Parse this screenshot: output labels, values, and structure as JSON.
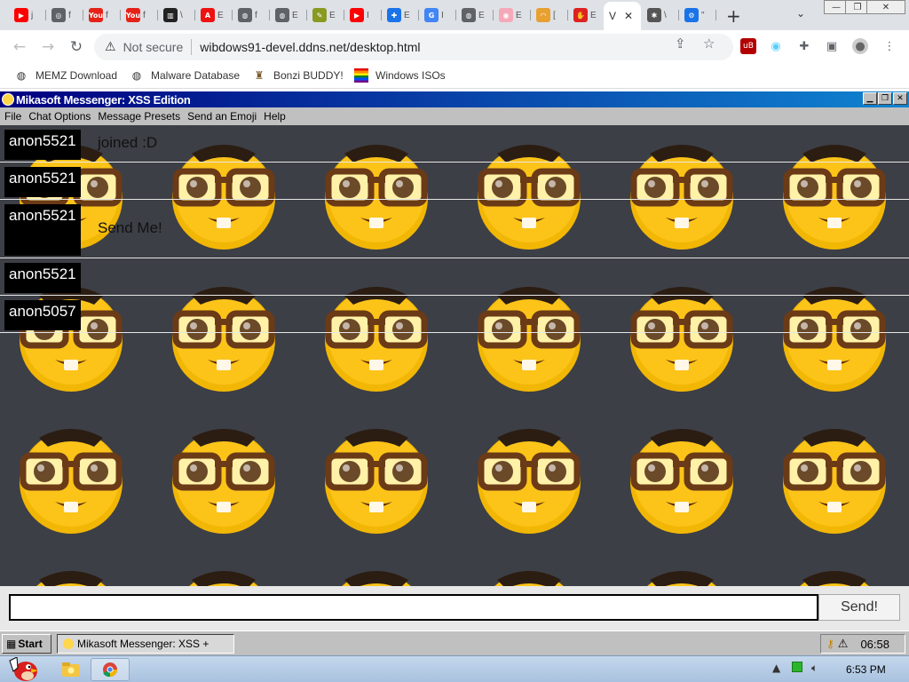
{
  "browser": {
    "tabs": [
      {
        "icon": "youtube-icon",
        "color": "#ff0000",
        "glyph": "▶",
        "label": "j"
      },
      {
        "icon": "chrome-icon",
        "color": "#5f6368",
        "glyph": "◎",
        "label": "f"
      },
      {
        "icon": "youtube-logo-icon",
        "color": "#e62117",
        "glyph": "You",
        "label": "f"
      },
      {
        "icon": "youtube-logo-icon",
        "color": "#e62117",
        "glyph": "You",
        "label": "f"
      },
      {
        "icon": "museum-icon",
        "color": "#222222",
        "glyph": "▥",
        "label": "\\"
      },
      {
        "icon": "adobe-icon",
        "color": "#ee1111",
        "glyph": "A",
        "label": "E"
      },
      {
        "icon": "globe-icon",
        "color": "#5f6368",
        "glyph": "◍",
        "label": "f"
      },
      {
        "icon": "globe-icon",
        "color": "#5f6368",
        "glyph": "◍",
        "label": "E"
      },
      {
        "icon": "paint-icon",
        "color": "#8a9a20",
        "glyph": "✎",
        "label": "E"
      },
      {
        "icon": "youtube-icon",
        "color": "#ff0000",
        "glyph": "▶",
        "label": "I"
      },
      {
        "icon": "puzzle-icon",
        "color": "#1a73e8",
        "glyph": "✚",
        "label": "E"
      },
      {
        "icon": "google-icon",
        "color": "#4285f4",
        "glyph": "G",
        "label": "I"
      },
      {
        "icon": "globe-icon",
        "color": "#5f6368",
        "glyph": "◍",
        "label": "E"
      },
      {
        "icon": "trans-flag-icon",
        "color": "#f5a9b8",
        "glyph": "◉",
        "label": "E"
      },
      {
        "icon": "rainbow-icon",
        "color": "#e8a030",
        "glyph": "◠",
        "label": "["
      },
      {
        "icon": "dislike-icon",
        "color": "#dd2222",
        "glyph": "✋",
        "label": "E"
      },
      {
        "icon": "bugs-icon",
        "color": "#555555",
        "glyph": "✱",
        "label": "\\"
      },
      {
        "icon": "settings-icon",
        "color": "#1a73e8",
        "glyph": "⚙",
        "label": "\""
      }
    ],
    "active_tab": {
      "label": "V",
      "close": "✕"
    },
    "new_tab": "+",
    "tab_search": "⌄",
    "omnibox": {
      "security_label": "Not secure",
      "url": "wibdows91-devel.ddns.net/desktop.html"
    },
    "bookmarks": [
      {
        "label": "MEMZ Download",
        "glyph": "◍"
      },
      {
        "label": "Malware Database",
        "glyph": "◍"
      },
      {
        "label": "Bonzi BUDDY!",
        "glyph": "♜"
      },
      {
        "label": "Windows ISOs",
        "glyph": "▤"
      }
    ]
  },
  "messenger": {
    "title": "Mikasoft Messenger: XSS Edition",
    "menu": [
      "File",
      "Chat Options",
      "Message Presets",
      "Send an Emoji",
      "Help"
    ],
    "messages": [
      {
        "user": "anon5521",
        "text": "joined :D",
        "height": 42,
        "text_top": 10
      },
      {
        "user": "anon5521",
        "text": "",
        "height": 42,
        "text_top": 10
      },
      {
        "user": "anon5521",
        "text": "Send Me!",
        "height": 66,
        "text_top": 22
      },
      {
        "user": "anon5521",
        "text": "",
        "height": 42,
        "text_top": 10
      },
      {
        "user": "anon5057",
        "text": "",
        "height": 42,
        "text_top": 10
      }
    ],
    "input_value": "",
    "send_label": "Send!"
  },
  "retro_taskbar": {
    "start_label": "Start",
    "task_label": "Mikasoft Messenger: XSS +",
    "clock": "06:58"
  },
  "win7_taskbar": {
    "clock": "6:53 PM"
  }
}
